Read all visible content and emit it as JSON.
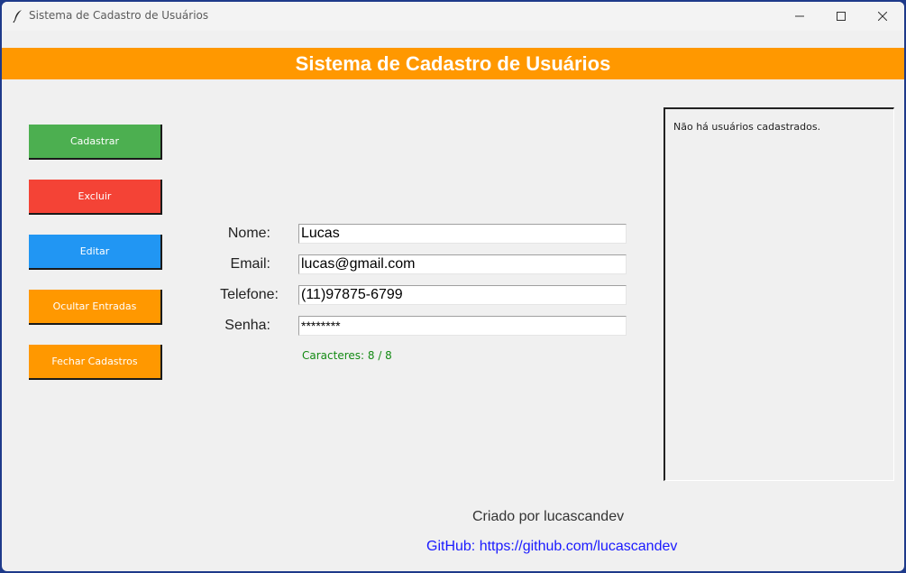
{
  "window": {
    "title": "Sistema de Cadastro de Usuários",
    "controls": [
      "minimize-icon",
      "maximize-icon",
      "close-icon"
    ]
  },
  "header": {
    "title": "Sistema de Cadastro de Usuários",
    "background": "#ff9800"
  },
  "sidebar": {
    "buttons": [
      {
        "label": "Cadastrar",
        "color": "#4caf50"
      },
      {
        "label": "Excluir",
        "color": "#f44336"
      },
      {
        "label": "Editar",
        "color": "#2196f3"
      },
      {
        "label": "Ocultar Entradas",
        "color": "#ff9800"
      },
      {
        "label": "Fechar Cadastros",
        "color": "#ff9800"
      }
    ]
  },
  "form": {
    "nome": {
      "label": "Nome:",
      "value": "Lucas"
    },
    "email": {
      "label": "Email:",
      "value": "lucas@gmail.com"
    },
    "telefone": {
      "label": "Telefone:",
      "value": "(11)97875-6799"
    },
    "senha": {
      "label": "Senha:",
      "value": "********"
    },
    "char_count": "Caracteres: 8 / 8"
  },
  "user_list": {
    "empty_message": "Não há usuários cadastrados."
  },
  "footer": {
    "credit": "Criado por lucascandev",
    "github": "GitHub: https://github.com/lucascandev"
  }
}
